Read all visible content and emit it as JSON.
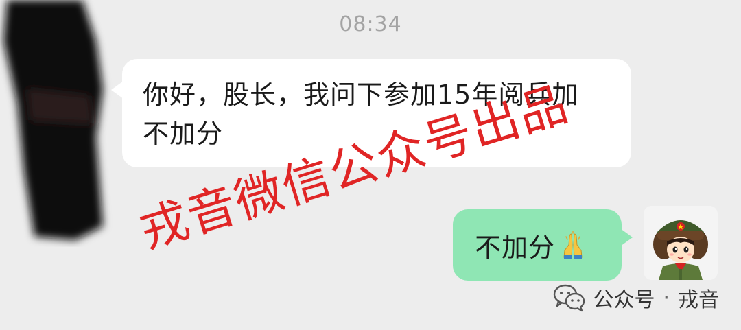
{
  "timestamp": "08:34",
  "incoming_message": {
    "text_line1": "你好，股长，我问下参加15年阅兵加",
    "text_line2": "不加分"
  },
  "outgoing_message": {
    "text": "不加分",
    "emoji_icon": "pray-hands-icon"
  },
  "watermark": {
    "text": "戎音微信公众号出品",
    "color": "#e02525"
  },
  "footer": {
    "icon": "wechat-icon",
    "account_type": "公众号",
    "separator": "·",
    "account_name": "戎音"
  },
  "colors": {
    "background": "#ededed",
    "incoming_bubble": "#ffffff",
    "outgoing_bubble": "#8fe6b4"
  }
}
